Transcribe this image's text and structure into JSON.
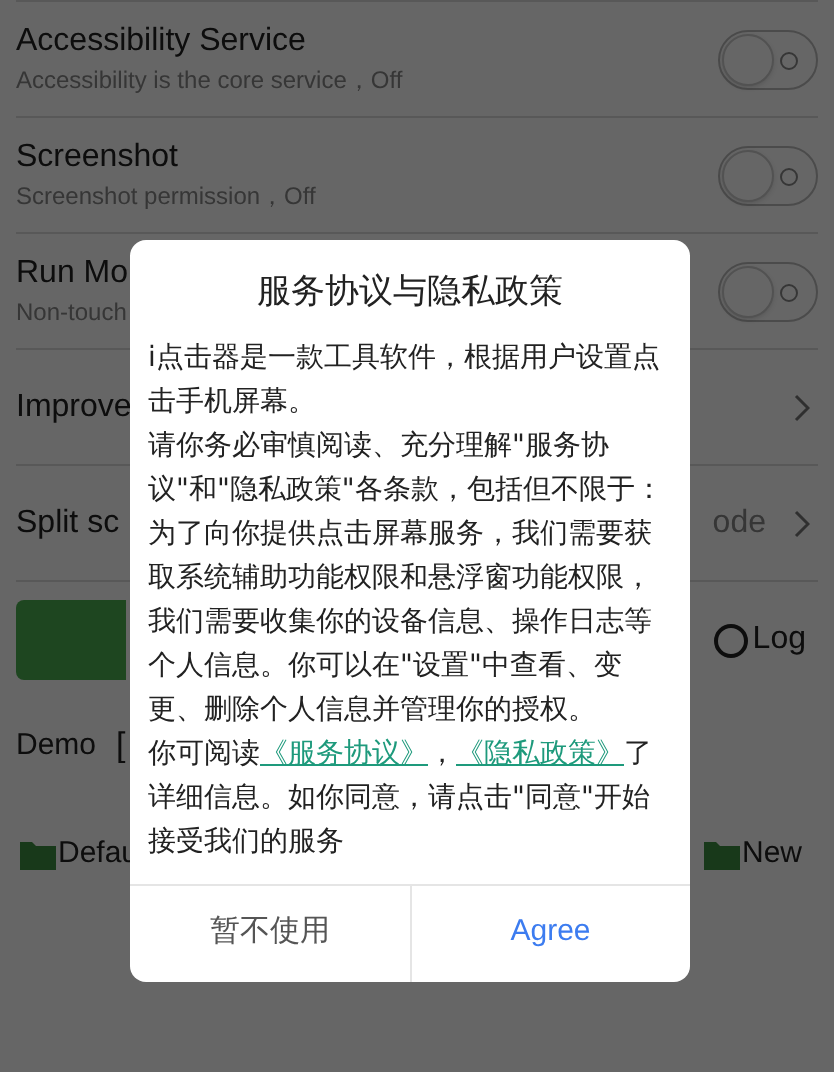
{
  "settings": [
    {
      "kind": "toggle",
      "title": "Accessibility Service",
      "subtitle": "Accessibility is the core service，Off",
      "on": false
    },
    {
      "kind": "toggle",
      "title": "Screenshot",
      "subtitle": "Screenshot permission，Off",
      "on": false
    },
    {
      "kind": "toggle",
      "title": "Run Mo",
      "subtitle": "Non-touch",
      "on": false
    },
    {
      "kind": "link",
      "title": "Improve"
    },
    {
      "kind": "link",
      "title": "Split sc",
      "value": "ode"
    }
  ],
  "actions": {
    "log_label": "Log",
    "log_selected": false
  },
  "demo": {
    "label": "Demo",
    "bracket": "["
  },
  "folders": [
    "Defau",
    "New"
  ],
  "dialog": {
    "title": "服务协议与隐私政策",
    "paragraphs": [
      "i点击器是一款工具软件，根据用户设置点击手机屏幕。",
      "请你务必审慎阅读、充分理解\"服务协议\"和\"隐私政策\"各条款，包括但不限于：为了向你提供点击屏幕服务，我们需要获取系统辅助功能权限和悬浮窗功能权限，我们需要收集你的设备信息、操作日志等个人信息。你可以在\"设置\"中查看、变更、删除个人信息并管理你的授权。"
    ],
    "links_sentence": {
      "before": "你可阅读",
      "link_1": "《服务协议》",
      "between": "，",
      "link_2": "《隐私政策》",
      "cut": "了",
      "after": "详细信息。如你同意，请点击\"同意\"开始接受我们的服务"
    },
    "buttons": [
      {
        "label": "暂不使用",
        "kind": "secondary"
      },
      {
        "label": "Agree",
        "kind": "primary"
      }
    ]
  }
}
